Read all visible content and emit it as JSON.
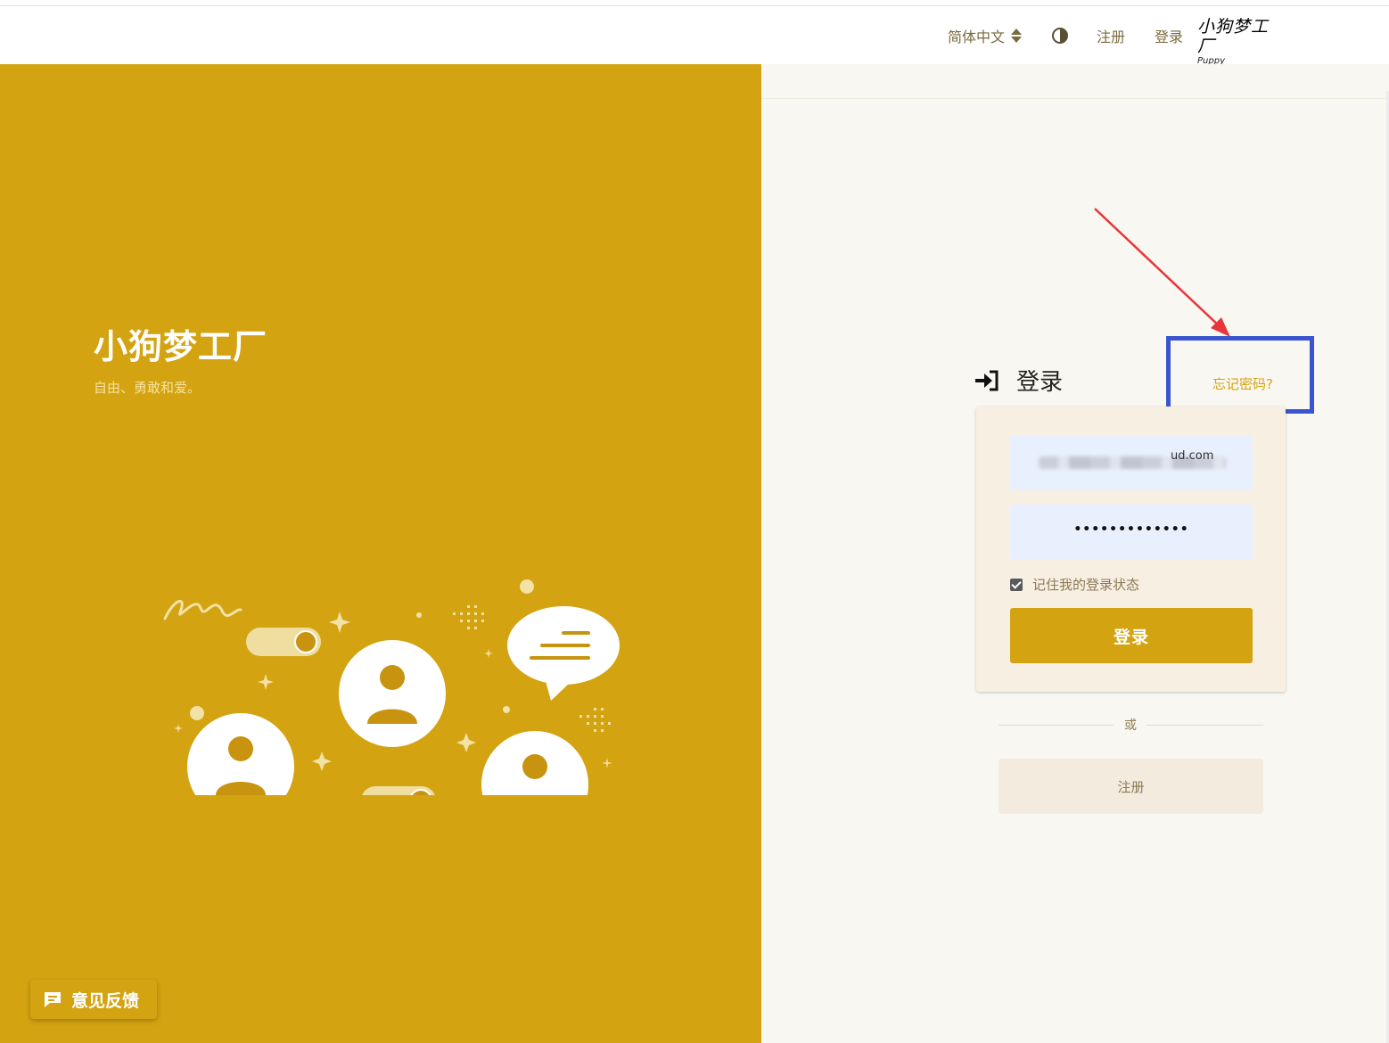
{
  "header": {
    "language": "简体中文",
    "register": "注册",
    "login": "登录",
    "logo_main": "小狗梦工厂",
    "logo_sub": "Puppy DreamWorks"
  },
  "left": {
    "brand_title": "小狗梦工厂",
    "brand_subtitle": "自由、勇敢和爱。",
    "feedback": "意见反馈"
  },
  "login": {
    "title": "登录",
    "forgot": "忘记密码?",
    "email_visible_tail": "ud.com",
    "password_mask": "•••••••••••••",
    "remember": "记住我的登录状态",
    "submit": "登录",
    "or": "或",
    "register": "注册"
  },
  "colors": {
    "brand": "#d4a311",
    "annotation_box": "#3a55cf",
    "annotation_arrow": "#e8353a"
  }
}
